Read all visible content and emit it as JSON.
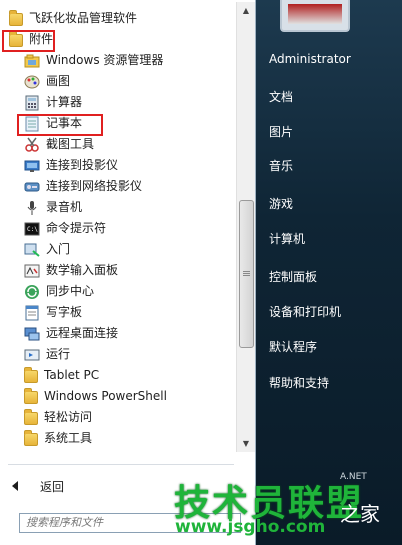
{
  "programs": {
    "items": [
      {
        "label": "飞跃化妆品管理软件",
        "icon": "folder-icon",
        "level": 0
      },
      {
        "label": "附件",
        "icon": "folder-icon",
        "level": 0
      },
      {
        "label": "Windows 资源管理器",
        "icon": "explorer-icon",
        "level": 1
      },
      {
        "label": "画图",
        "icon": "paint-icon",
        "level": 1
      },
      {
        "label": "计算器",
        "icon": "calculator-icon",
        "level": 1
      },
      {
        "label": "记事本",
        "icon": "notepad-icon",
        "level": 1
      },
      {
        "label": "截图工具",
        "icon": "scissors-icon",
        "level": 1
      },
      {
        "label": "连接到投影仪",
        "icon": "projector-icon",
        "level": 1
      },
      {
        "label": "连接到网络投影仪",
        "icon": "network-projector-icon",
        "level": 1
      },
      {
        "label": "录音机",
        "icon": "microphone-icon",
        "level": 1
      },
      {
        "label": "命令提示符",
        "icon": "cmd-icon",
        "level": 1
      },
      {
        "label": "入门",
        "icon": "getting-started-icon",
        "level": 1
      },
      {
        "label": "数学输入面板",
        "icon": "math-input-icon",
        "level": 1
      },
      {
        "label": "同步中心",
        "icon": "sync-icon",
        "level": 1
      },
      {
        "label": "写字板",
        "icon": "wordpad-icon",
        "level": 1
      },
      {
        "label": "远程桌面连接",
        "icon": "remote-desktop-icon",
        "level": 1
      },
      {
        "label": "运行",
        "icon": "run-icon",
        "level": 1
      },
      {
        "label": "Tablet PC",
        "icon": "folder-icon",
        "level": 1
      },
      {
        "label": "Windows PowerShell",
        "icon": "folder-icon",
        "level": 1
      },
      {
        "label": "轻松访问",
        "icon": "folder-icon",
        "level": 1
      },
      {
        "label": "系统工具",
        "icon": "folder-icon",
        "level": 1
      }
    ],
    "back_label": "返回",
    "search_placeholder": "搜索程序和文件"
  },
  "right": {
    "items": [
      "Administrator",
      "文档",
      "图片",
      "音乐",
      "游戏",
      "计算机",
      "控制面板",
      "设备和打印机",
      "默认程序",
      "帮助和支持"
    ]
  },
  "watermark": {
    "title": "技术员联盟",
    "url": "www.jsgho.com",
    "suffix": "之家",
    "small": "A.NET"
  },
  "colors": {
    "highlight_border": "#e02020",
    "right_pane": "#0f2535",
    "watermark_green": "#1fb43a"
  }
}
